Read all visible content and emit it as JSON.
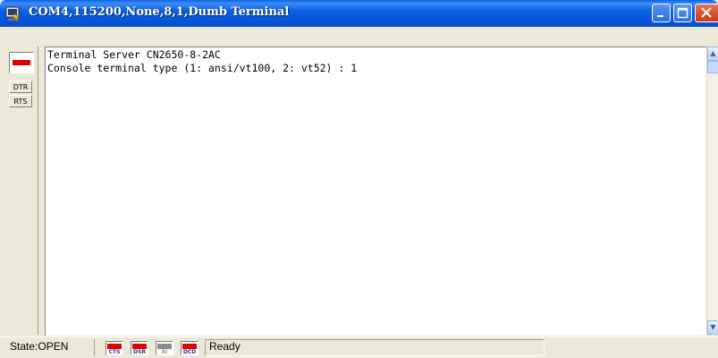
{
  "window": {
    "title": "COM4,115200,None,8,1,Dumb Terminal",
    "controls": [
      "minimize-icon",
      "maximize-icon",
      "close-icon"
    ]
  },
  "signal_panel": {
    "buttons": [
      {
        "label": "DTR"
      },
      {
        "label": "RTS"
      }
    ],
    "led_color": "#E00000"
  },
  "terminal": {
    "lines": [
      "Terminal Server CN2650-8-2AC",
      "Console terminal type (1: ansi/vt100, 2: vt52) : 1"
    ]
  },
  "status": {
    "state": "State:OPEN",
    "indicators": [
      {
        "label": "CTS",
        "active": true,
        "color": "#E00000"
      },
      {
        "label": "DSR",
        "active": true,
        "color": "#E00000"
      },
      {
        "label": "RI",
        "active": false,
        "color": "#8c8c8c"
      },
      {
        "label": "DCD",
        "active": true,
        "color": "#E00000"
      }
    ],
    "message": "Ready"
  }
}
